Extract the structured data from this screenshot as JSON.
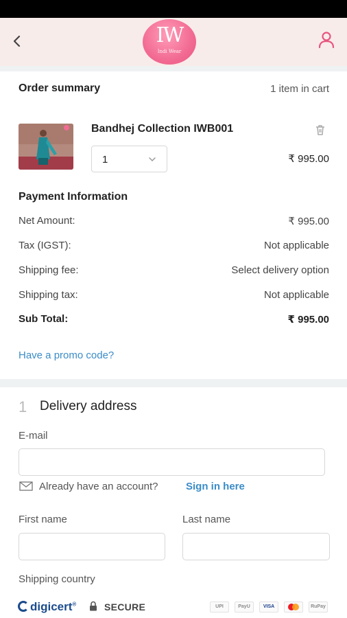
{
  "header": {
    "logo_mark": "IW",
    "logo_sub": "Indi Wear"
  },
  "summary": {
    "title": "Order summary",
    "cart_count": "1 item in cart"
  },
  "item": {
    "name": "Bandhej Collection IWB001",
    "quantity": "1",
    "price": "₹ 995.00"
  },
  "payment": {
    "title": "Payment Information",
    "rows": [
      {
        "label": "Net Amount:",
        "value": "₹ 995.00"
      },
      {
        "label": "Tax (IGST):",
        "value": "Not applicable"
      },
      {
        "label": "Shipping fee:",
        "value": "Select delivery option"
      },
      {
        "label": "Shipping tax:",
        "value": "Not applicable"
      },
      {
        "label": "Sub Total:",
        "value": "₹ 995.00"
      }
    ]
  },
  "promo": {
    "label": "Have a promo code?"
  },
  "delivery": {
    "step_number": "1",
    "title": "Delivery address",
    "email_label": "E-mail",
    "email_value": "",
    "account_prompt": "Already have an account?",
    "sign_in_label": "Sign in here",
    "first_name_label": "First name",
    "first_name_value": "",
    "last_name_label": "Last name",
    "last_name_value": "",
    "country_label": "Shipping country"
  },
  "footer": {
    "brand": "digicert",
    "brand_mark": "®",
    "secure_label": "SECURE",
    "payment_logos": [
      "UPI",
      "PayU",
      "VISA",
      "MC",
      "RuPay"
    ]
  },
  "colors": {
    "header_bg": "#f8ecea",
    "brand_pink": "#e7557f",
    "link_blue": "#3a8cc7",
    "digicert_blue": "#1b4b8c"
  }
}
